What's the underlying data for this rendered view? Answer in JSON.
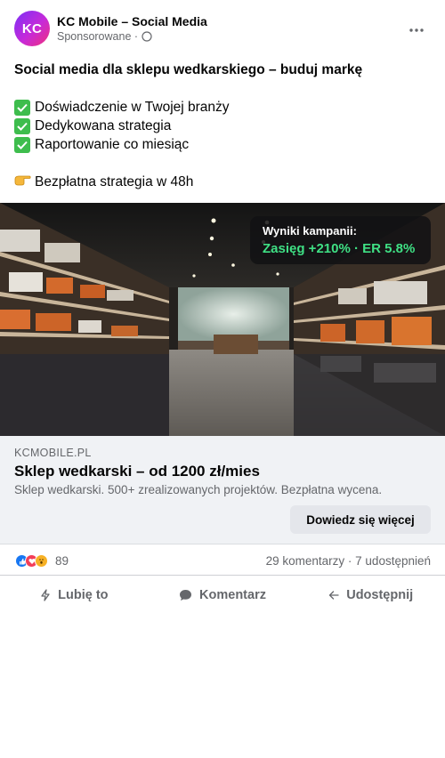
{
  "header": {
    "avatar_initials": "KC",
    "page_name": "KC Mobile – Social Media",
    "sponsored": "Sponsorowane ·"
  },
  "post": {
    "headline": "Social media dla sklepu wedkarskiego – buduj markę",
    "bullets": [
      "Doświadczenie w Twojej branży",
      "Dedykowana strategia",
      "Raportowanie co miesiąc"
    ],
    "cta_line": "Bezpłatna strategia w 48h"
  },
  "image": {
    "badge_label": "Wyniki kampanii:",
    "badge_value": "Zasięg +210% · ER 5.8%"
  },
  "link": {
    "domain": "KCMOBILE.PL",
    "title": "Sklep wedkarski – od 1200 zł/mies",
    "description": "Sklep wedkarski. 500+ zrealizowanych projektów. Bezpłatna wycena.",
    "button_label": "Dowiedz się więcej"
  },
  "reactions": {
    "count": "89",
    "stats": "29 komentarzy · 7 udostępnień",
    "icons": [
      "like-icon",
      "love-icon",
      "wow-icon"
    ]
  },
  "actions": {
    "like": "Lubię to",
    "comment": "Komentarz",
    "share": "Udostępnij"
  },
  "colors": {
    "badge_accent": "#3fe084",
    "link_box_bg": "#f0f2f5",
    "muted_text": "#65676b"
  }
}
